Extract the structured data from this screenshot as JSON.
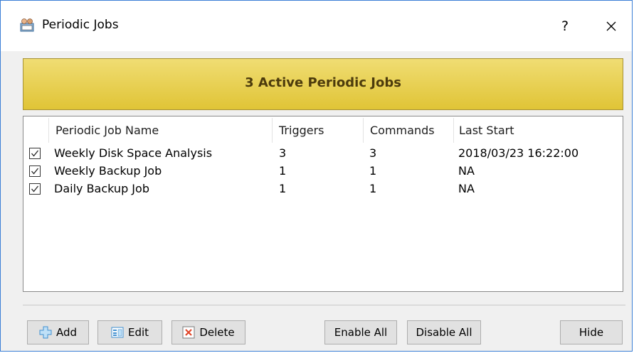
{
  "window": {
    "title": "Periodic Jobs",
    "help_label": "?"
  },
  "banner": {
    "text": "3 Active Periodic Jobs"
  },
  "columns": [
    "Periodic Job Name",
    "Triggers",
    "Commands",
    "Last Start"
  ],
  "jobs": [
    {
      "enabled": true,
      "name": "Weekly Disk Space Analysis",
      "triggers": "3",
      "commands": "3",
      "last_start": "2018/03/23 16:22:00"
    },
    {
      "enabled": true,
      "name": "Weekly Backup Job",
      "triggers": "1",
      "commands": "1",
      "last_start": "NA"
    },
    {
      "enabled": true,
      "name": "Daily Backup Job",
      "triggers": "1",
      "commands": "1",
      "last_start": "NA"
    }
  ],
  "buttons": {
    "add": "Add",
    "edit": "Edit",
    "delete": "Delete",
    "enable_all": "Enable All",
    "disable_all": "Disable All",
    "hide": "Hide"
  },
  "icons": {
    "app": "periodic-jobs-app-icon",
    "close": "close-icon",
    "add": "add-plus-icon",
    "edit": "edit-icon",
    "delete": "delete-x-icon",
    "checkbox": "checkmark-icon"
  },
  "colors": {
    "banner_top": "#f0dd73",
    "banner_bottom": "#e0c436",
    "banner_text": "#4c3b0c",
    "window_border": "#3b7fd6",
    "button_bg": "#e1e1e1"
  }
}
